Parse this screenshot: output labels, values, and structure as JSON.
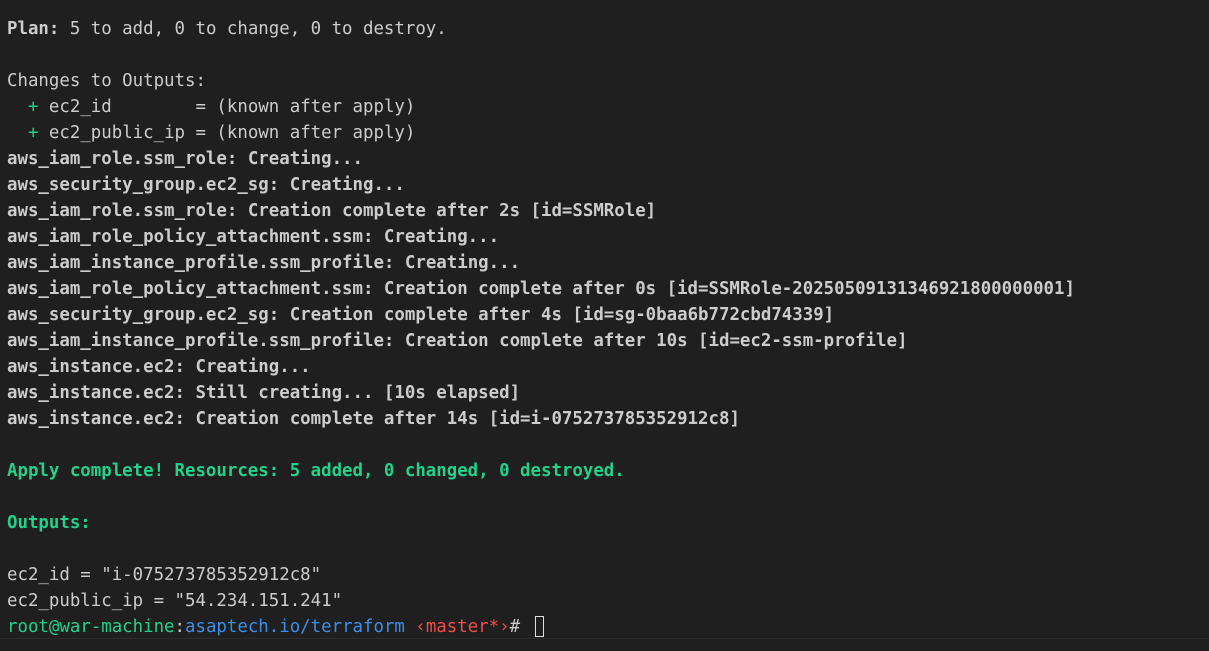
{
  "plan": {
    "label": "Plan:",
    "text": " 5 to add, 0 to change, 0 to destroy."
  },
  "outputs_changes": {
    "header": "Changes to Outputs:",
    "items": [
      {
        "sign": "+",
        "text": " ec2_id        = (known after apply)"
      },
      {
        "sign": "+",
        "text": " ec2_public_ip = (known after apply)"
      }
    ]
  },
  "log": [
    {
      "resource": "aws_iam_role.ssm_role:",
      "message": " Creating..."
    },
    {
      "resource": "aws_security_group.ec2_sg:",
      "message": " Creating..."
    },
    {
      "resource": "aws_iam_role.ssm_role:",
      "message": " Creation complete after 2s [id=SSMRole]"
    },
    {
      "resource": "aws_iam_role_policy_attachment.ssm:",
      "message": " Creating..."
    },
    {
      "resource": "aws_iam_instance_profile.ssm_profile:",
      "message": " Creating..."
    },
    {
      "resource": "aws_iam_role_policy_attachment.ssm:",
      "message": " Creation complete after 0s [id=SSMRole-20250509131346921800000001]"
    },
    {
      "resource": "aws_security_group.ec2_sg:",
      "message": " Creation complete after 4s [id=sg-0baa6b772cbd74339]"
    },
    {
      "resource": "aws_iam_instance_profile.ssm_profile:",
      "message": " Creation complete after 10s [id=ec2-ssm-profile]"
    },
    {
      "resource": "aws_instance.ec2:",
      "message": " Creating..."
    },
    {
      "resource": "aws_instance.ec2:",
      "message": " Still creating... [10s elapsed]"
    },
    {
      "resource": "aws_instance.ec2:",
      "message": " Creation complete after 14s [id=i-075273785352912c8]"
    }
  ],
  "apply_complete": "Apply complete! Resources: 5 added, 0 changed, 0 destroyed.",
  "outputs": {
    "header": "Outputs:",
    "values": [
      "ec2_id = \"i-075273785352912c8\"",
      "ec2_public_ip = \"54.234.151.241\""
    ]
  },
  "prompt": {
    "user_host": "root@war-machine",
    "colon": ":",
    "path": "asaptech.io/terraform",
    "branch": " ‹master*›",
    "symbol": "# "
  },
  "colors": {
    "background": "#1f1f1f",
    "foreground": "#cccccc",
    "green": "#23d18b",
    "blue": "#3b8eea",
    "red": "#f14c4c"
  }
}
